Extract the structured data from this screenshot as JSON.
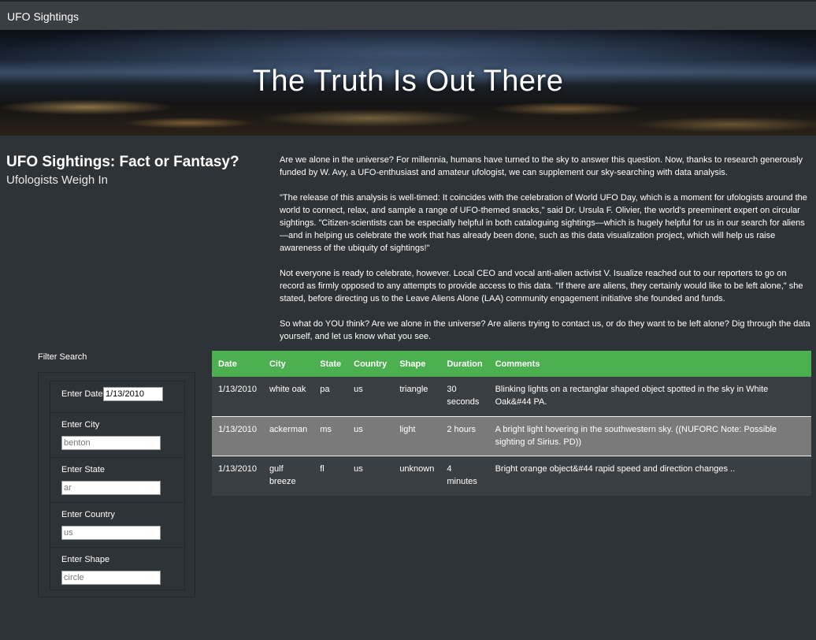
{
  "navbar": {
    "brand": "UFO Sightings"
  },
  "hero": {
    "title": "The Truth Is Out There"
  },
  "headline": {
    "title": "UFO Sightings: Fact or Fantasy?",
    "subtitle": "Ufologists Weigh In"
  },
  "article": {
    "paragraphs": [
      "Are we alone in the universe? For millennia, humans have turned to the sky to answer this question. Now, thanks to research generously funded by W. Avy, a UFO-enthusiast and amateur ufologist, we can supplement our sky-searching with data analysis.",
      "\"The release of this analysis is well-timed: It coincides with the celebration of World UFO Day, which is a moment for ufologists around the world to connect, relax, and sample a range of UFO-themed snacks,\" said Dr. Ursula F. Olivier, the world's preeminent expert on circular sightings. \"Citizen-scientists can be especially helpful in both cataloguing sightings—which is hugely helpful for us in our search for aliens—and in helping us celebrate the work that has already been done, such as this data visualization project, which will help us raise awareness of the ubiquity of sightings!\"",
      "Not everyone is ready to celebrate, however. Local CEO and vocal anti-alien activist V. Isualize reached out to our reporters to go on record as firmly opposed to any attempts to provide access to this data. \"If there are aliens, they certainly would like to be left alone,\" she stated, before directing us to the Leave Aliens Alone (LAA) community engagement initiative she founded and funds.",
      "So what do YOU think? Are we alone in the universe? Are aliens trying to contact us, or do they want to be left alone? Dig through the data yourself, and let us know what you see."
    ]
  },
  "filters": {
    "title": "Filter Search",
    "items": [
      {
        "label": "Enter Date",
        "value": "1/13/2010",
        "placeholder": ""
      },
      {
        "label": "Enter City",
        "value": "",
        "placeholder": "benton"
      },
      {
        "label": "Enter State",
        "value": "",
        "placeholder": "ar"
      },
      {
        "label": "Enter Country",
        "value": "",
        "placeholder": "us"
      },
      {
        "label": "Enter Shape",
        "value": "",
        "placeholder": "circle"
      }
    ]
  },
  "table": {
    "headers": [
      "Date",
      "City",
      "State",
      "Country",
      "Shape",
      "Duration",
      "Comments"
    ],
    "rows": [
      [
        "1/13/2010",
        "white oak",
        "pa",
        "us",
        "triangle",
        "30 seconds",
        "Blinking lights on a rectanglar shaped object spotted in the sky in White Oak&#44 PA."
      ],
      [
        "1/13/2010",
        "ackerman",
        "ms",
        "us",
        "light",
        "2 hours",
        "A bright light hovering in the southwestern sky. ((NUFORC Note: Possible sighting of Sirius. PD))"
      ],
      [
        "1/13/2010",
        "gulf breeze",
        "fl",
        "us",
        "unknown",
        "4 minutes",
        "Bright orange object&#44 rapid speed and direction changes .."
      ]
    ]
  },
  "colors": {
    "background": "#2e3338",
    "navbar": "#3a3f44",
    "table_header": "#4caf50",
    "row_highlight": "#7a7a7a"
  }
}
